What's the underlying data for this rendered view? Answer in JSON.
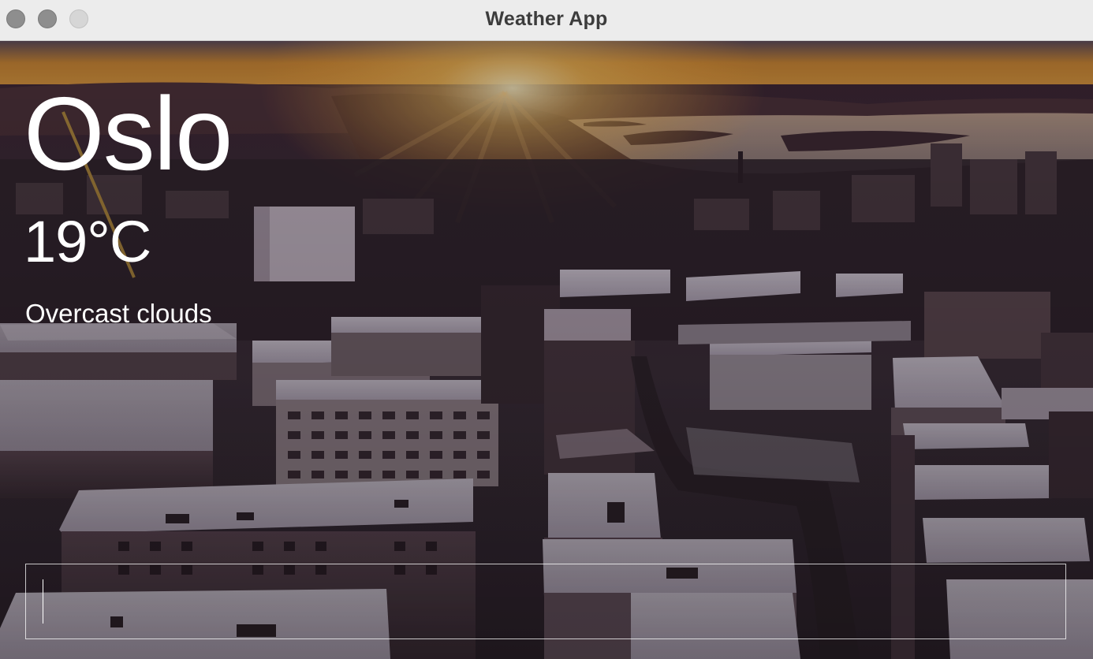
{
  "window": {
    "title": "Weather App"
  },
  "weather": {
    "city": "Oslo",
    "temperature": "19°C",
    "description": "Overcast clouds"
  },
  "search": {
    "value": "",
    "placeholder": ""
  },
  "colors": {
    "text": "#ffffff",
    "titlebar": "#ececec",
    "sky_glow": "#f0a030"
  }
}
